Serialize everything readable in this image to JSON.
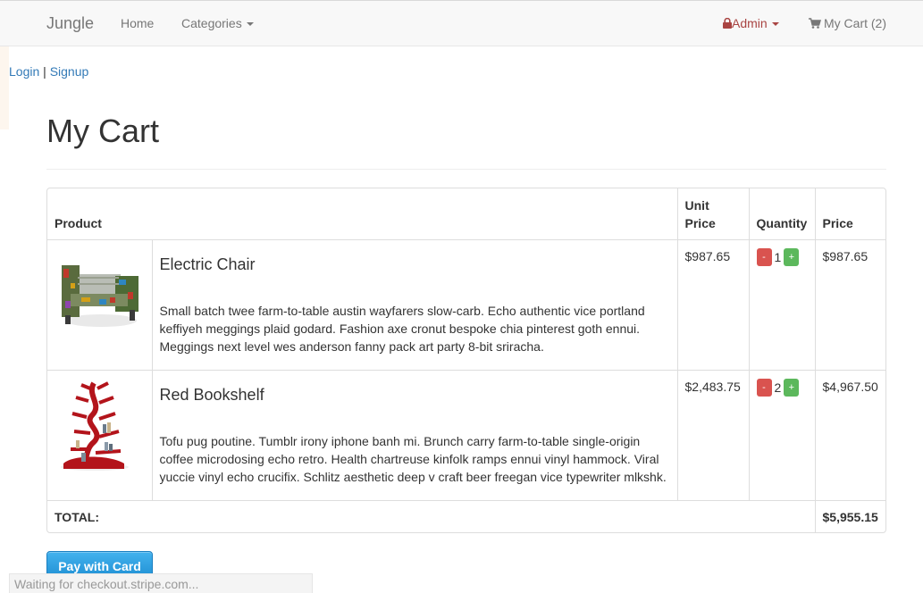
{
  "navbar": {
    "brand": "Jungle",
    "home": "Home",
    "categories": "Categories",
    "admin": "Admin",
    "cart": "My Cart (2)"
  },
  "auth": {
    "login": "Login",
    "separator": "|",
    "signup": "Signup"
  },
  "page": {
    "title": "My Cart"
  },
  "table": {
    "headers": {
      "product": "Product",
      "unit_price": "Unit Price",
      "quantity": "Quantity",
      "price": "Price"
    },
    "items": [
      {
        "name": "Electric Chair",
        "description": "Small batch twee farm-to-table austin wayfarers slow-carb. Echo authentic vice portland keffiyeh meggings plaid godard. Fashion axe cronut bespoke chia pinterest goth ennui. Meggings next level wes anderson fanny pack art party 8-bit sriracha.",
        "unit_price": "$987.65",
        "quantity": "1",
        "price": "$987.65"
      },
      {
        "name": "Red Bookshelf",
        "description": "Tofu pug poutine. Tumblr irony iphone banh mi. Brunch carry farm-to-table single-origin coffee microdosing echo retro. Health chartreuse kinfolk ramps ennui vinyl hammock. Viral yuccie vinyl echo crucifix. Schlitz aesthetic deep v craft beer freegan vice typewriter mlkshk.",
        "unit_price": "$2,483.75",
        "quantity": "2",
        "price": "$4,967.50"
      }
    ],
    "qty_minus": "-",
    "qty_plus": "+",
    "total_label": "TOTAL:",
    "total_value": "$5,955.15"
  },
  "checkout": {
    "pay_label": "Pay with Card"
  },
  "status_bar": {
    "text": "Waiting for checkout.stripe.com..."
  },
  "colors": {
    "accent_link": "#337ab7",
    "admin": "#a94442",
    "danger": "#d9534f",
    "success": "#5cb85c",
    "stripe_button": "#1f8fd3"
  },
  "icons": {
    "admin": "lock-icon",
    "cart": "shopping-cart-icon",
    "menu": "caret-down-icon"
  }
}
